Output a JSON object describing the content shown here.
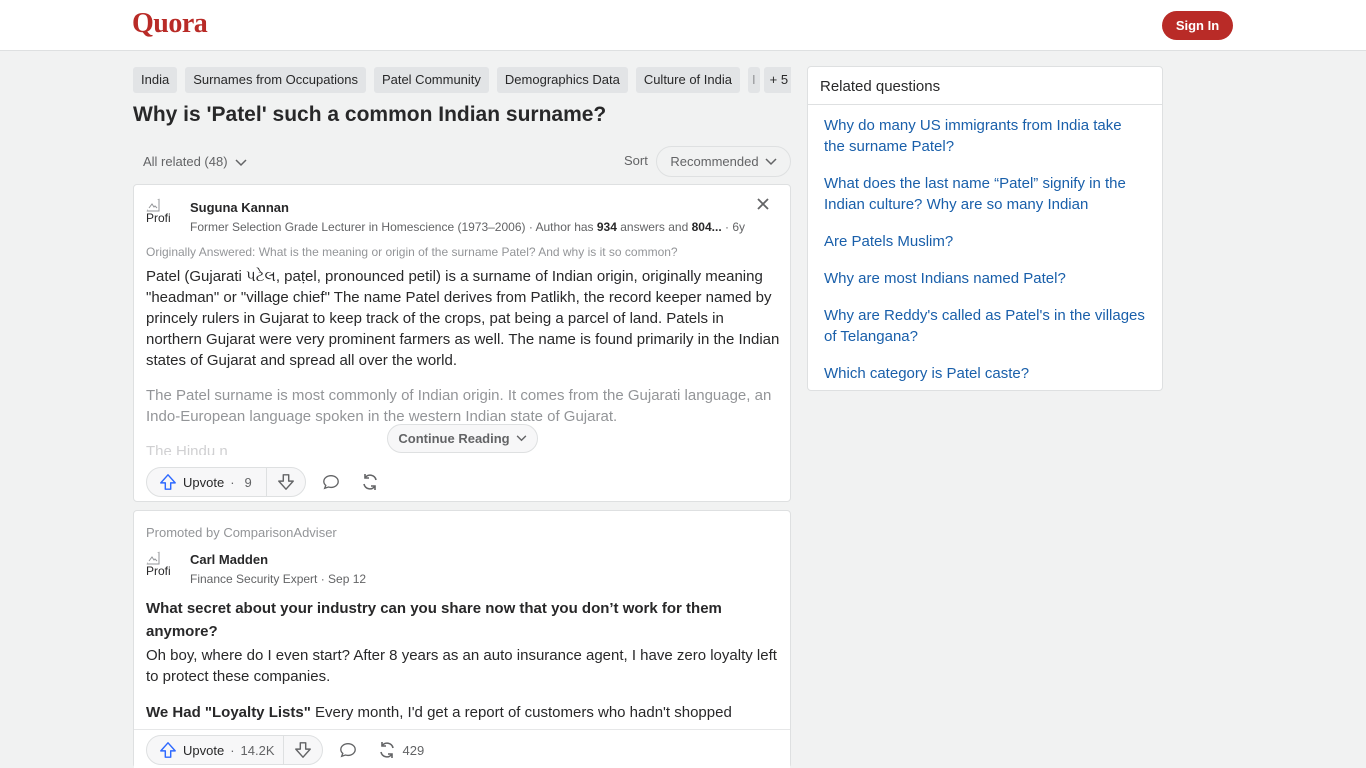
{
  "header": {
    "logo": "Quora",
    "sign_in": "Sign In"
  },
  "topics": [
    "India",
    "Surnames from Occupations",
    "Patel Community",
    "Demographics Data",
    "Culture of India",
    "I",
    "+ 5"
  ],
  "question": {
    "title": "Why is 'Patel' such a common Indian surname?"
  },
  "filter": {
    "label": "All related (48)",
    "sort_label": "Sort",
    "sort_value": "Recommended"
  },
  "answer1": {
    "avatar_alt": "Profi",
    "author": "Suguna Kannan",
    "cred_pre": "Former Selection Grade Lecturer in Homescience (1973–2006) · Author has ",
    "cred_answers": "934",
    "cred_mid": " answers and ",
    "cred_views": "804...",
    "cred_time": " · 6y",
    "originally": "Originally Answered: What is the meaning or origin of the surname Patel? And why is it so common?",
    "para1": "Patel (Gujarati પટેલ, paṭel, pronounced petil) is a surname of Indian origin, originally meaning \"headman\" or \"village chief\" The name Patel derives from Patlikh, the record keeper named by princely rulers in Gujarat to keep track of the crops, pat being a parcel of land. Patels in northern Gujarat were very prominent farmers as well. The name is found primarily in the Indian states of Gujarat and spread all over the world.",
    "para2": "The Patel surname is most commonly of Indian origin. It comes from the Gujarati language, an Indo-European language spoken in the western Indian state of Gujarat.",
    "para3": "The Hindu n",
    "continue": "Continue Reading",
    "upvote_label": "Upvote",
    "upvote_count": "9"
  },
  "answer2": {
    "promoted": "Promoted by ComparisonAdviser",
    "avatar_alt": "Profi",
    "author": "Carl Madden",
    "cred": "Finance Security Expert · Sep 12",
    "title": "What secret about your industry can you share now that you don’t work for them anymore?",
    "para1": "Oh boy, where do I even start? After 8 years as an auto insurance agent, I have zero loyalty left to protect these companies.",
    "para2_bold": "We Had \"Loyalty Lists\"",
    "para2_rest": " Every month, I'd get a report of customers who hadn't shopped",
    "upvote_label": "Upvote",
    "upvote_count": "14.2K",
    "share_count": "429"
  },
  "related": {
    "title": "Related questions",
    "items": [
      "Why do many US immigrants from India take the surname Patel?",
      "What does the last name “Patel” signify in the Indian culture? Why are so many Indian people...",
      "Are Patels Muslim?",
      "Why are most Indians named Patel?",
      "Why are Reddy's called as Patel's in the villages of Telangana?",
      "Which category is Patel caste?"
    ]
  },
  "colors": {
    "brand": "#b92b27",
    "link": "#195faa",
    "upvote": "#2e69ff"
  }
}
